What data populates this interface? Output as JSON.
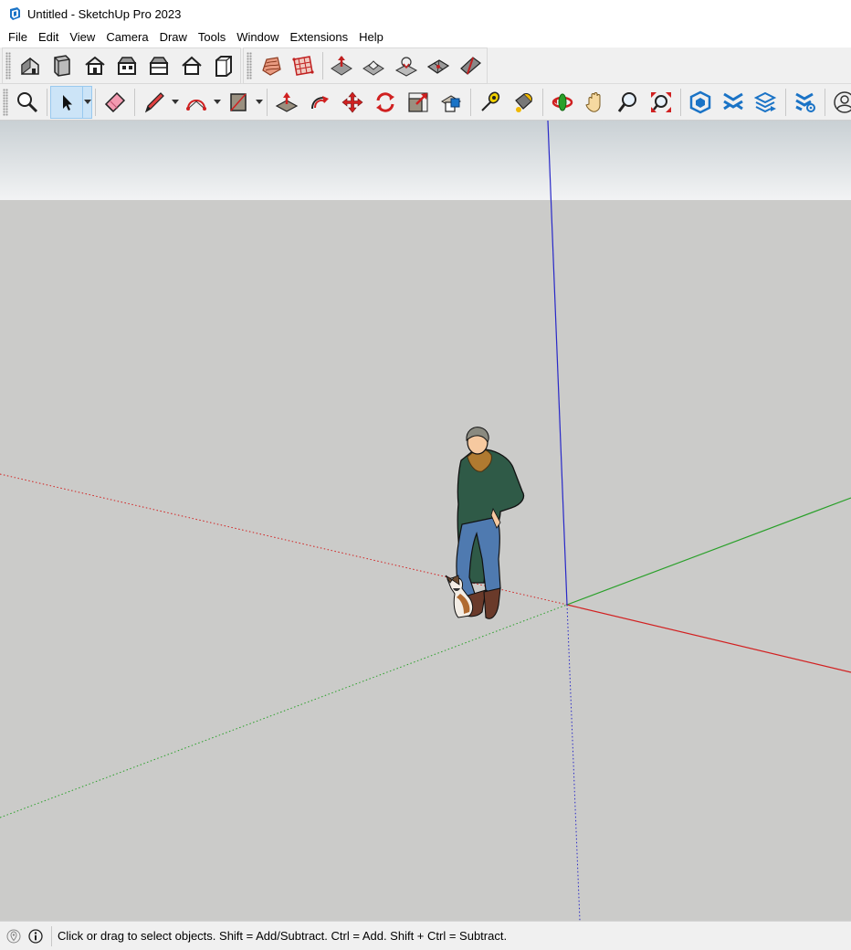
{
  "window": {
    "title": "Untitled - SketchUp Pro 2023",
    "app_icon": "sketchup-logo-icon"
  },
  "menu": [
    {
      "label": "File"
    },
    {
      "label": "Edit"
    },
    {
      "label": "View"
    },
    {
      "label": "Camera"
    },
    {
      "label": "Draw"
    },
    {
      "label": "Tools"
    },
    {
      "label": "Window"
    },
    {
      "label": "Extensions"
    },
    {
      "label": "Help"
    }
  ],
  "toolbar_views": {
    "icons": [
      "iso-view-icon",
      "top-view-icon",
      "front-view-icon",
      "right-view-icon",
      "back-view-icon",
      "left-view-icon",
      "bottom-view-icon"
    ]
  },
  "toolbar_sandbox": {
    "icons": [
      "sandbox-from-contours-icon",
      "sandbox-from-scratch-icon",
      "smoove-icon",
      "stamp-icon",
      "drape-icon",
      "add-detail-icon",
      "flip-edge-icon"
    ]
  },
  "toolbar_main": {
    "icons": [
      "search-icon",
      "select-icon",
      "eraser-icon",
      "pencil-line-icon",
      "arc-icon",
      "rectangle-icon",
      "push-pull-icon",
      "follow-me-icon",
      "move-icon",
      "rotate-icon",
      "scale-icon",
      "offset-icon",
      "tape-measure-icon",
      "paint-bucket-icon",
      "orbit-icon",
      "pan-icon",
      "zoom-icon",
      "zoom-extents-icon",
      "3d-warehouse-icon",
      "extension-warehouse-icon",
      "layout-icon",
      "extension-manager-icon",
      "user-account-icon"
    ],
    "active": "select-icon"
  },
  "colors": {
    "sky_top": "#c9d0d4",
    "sky_bottom": "#f2f3f4",
    "ground": "#cbcbc9",
    "axis_red": "#d22020",
    "axis_green": "#2aa02a",
    "axis_blue": "#2828c8",
    "accent_blue": "#1a73c6"
  },
  "status": {
    "text": "Click or drag to select objects. Shift = Add/Subtract. Ctrl = Add. Shift + Ctrl = Subtract.",
    "icons": [
      "geo-location-icon",
      "instructor-info-icon"
    ]
  }
}
